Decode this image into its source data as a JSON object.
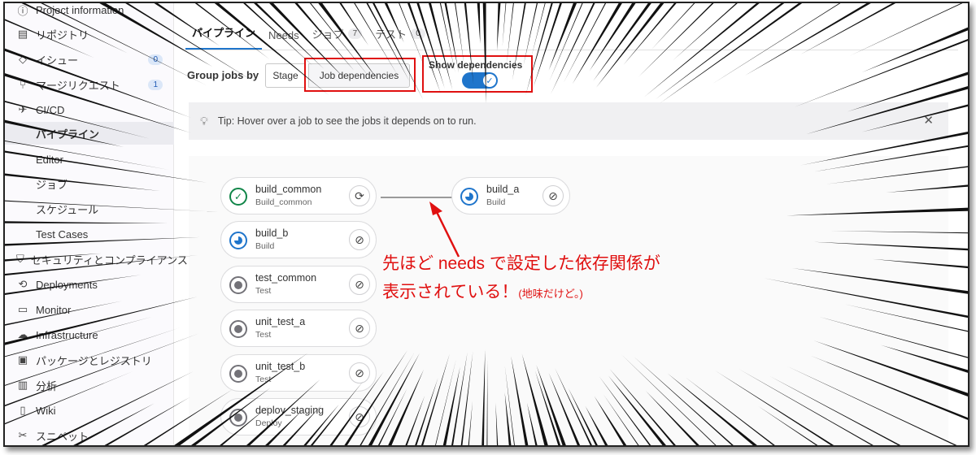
{
  "sidebar": {
    "items": [
      {
        "label": "Project information",
        "icon": "info-icon"
      },
      {
        "label": "リポジトリ",
        "icon": "repository-icon"
      },
      {
        "label": "イシュー",
        "icon": "issues-icon",
        "count": "0"
      },
      {
        "label": "マージリクエスト",
        "icon": "merge-request-icon",
        "count": "1"
      },
      {
        "label": "CI/CD",
        "icon": "rocket-icon"
      },
      {
        "label": "パイプライン"
      },
      {
        "label": "Editor"
      },
      {
        "label": "ジョブ"
      },
      {
        "label": "スケジュール"
      },
      {
        "label": "Test Cases"
      },
      {
        "label": "セキュリティとコンプライアンス",
        "icon": "shield-icon"
      },
      {
        "label": "Deployments",
        "icon": "deployments-icon"
      },
      {
        "label": "Monitor",
        "icon": "monitor-icon"
      },
      {
        "label": "Infrastructure",
        "icon": "cloud-icon"
      },
      {
        "label": "パッケージとレジストリ",
        "icon": "package-icon"
      },
      {
        "label": "分析",
        "icon": "chart-icon"
      },
      {
        "label": "Wiki",
        "icon": "book-icon"
      },
      {
        "label": "スニペット",
        "icon": "snippet-icon"
      }
    ]
  },
  "tabs": [
    {
      "label": "パイプライン"
    },
    {
      "label": "Needs"
    },
    {
      "label": "ジョブ",
      "count": "7"
    },
    {
      "label": "テスト",
      "count": "0"
    }
  ],
  "toolbar": {
    "group_label": "Group jobs by",
    "stage_label": "Stage",
    "job_dep_label": "Job dependencies",
    "show_dep_label": "Show dependencies",
    "show_dep_on": true
  },
  "tip": {
    "text": "Tip: Hover over a job to see the jobs it depends on to run."
  },
  "jobs": [
    {
      "name": "build_common",
      "stage": "Build_common",
      "status": "success",
      "action": "retry-icon"
    },
    {
      "name": "build_a",
      "stage": "Build",
      "status": "running",
      "action": "cancel-icon"
    },
    {
      "name": "build_b",
      "stage": "Build",
      "status": "running",
      "action": "cancel-icon"
    },
    {
      "name": "test_common",
      "stage": "Test",
      "status": "created",
      "action": "cancel-icon"
    },
    {
      "name": "unit_test_a",
      "stage": "Test",
      "status": "created",
      "action": "cancel-icon"
    },
    {
      "name": "unit_test_b",
      "stage": "Test",
      "status": "created",
      "action": "cancel-icon"
    },
    {
      "name": "deploy_staging",
      "stage": "Deploy",
      "status": "created",
      "action": "cancel-icon"
    }
  ],
  "annotation": {
    "line1": "先ほど needs で設定した依存関係が",
    "line2": "表示されている！",
    "line2_small": "(地味だけど。)"
  },
  "colors": {
    "accent": "#1f75cb",
    "success": "#108548",
    "annotation_red": "#e01010"
  }
}
